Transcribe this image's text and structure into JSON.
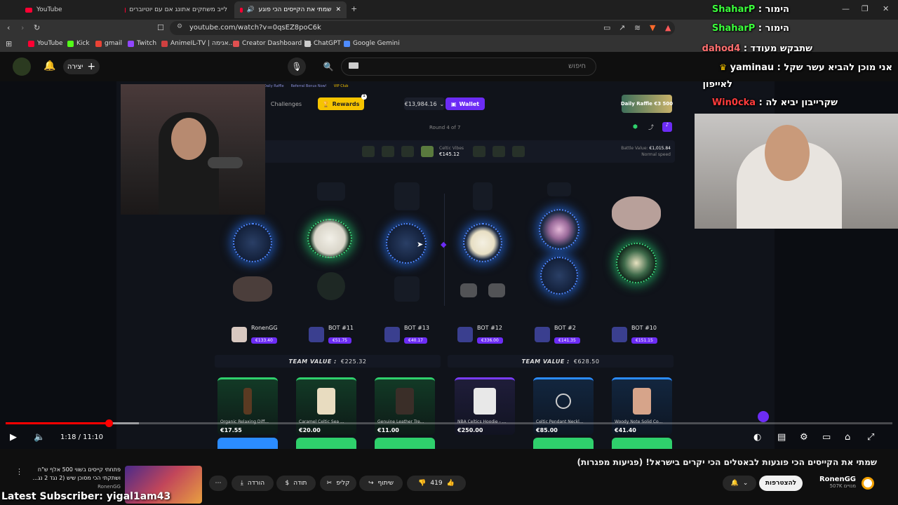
{
  "browser": {
    "tabs": [
      {
        "label": "YouTube"
      },
      {
        "label": "לייב משחקים אתונג אם עם יוטיוברים"
      },
      {
        "label": "שמתי את הקייסים הכי פוגעים לבאטלים הכי יקרים בישראל! (פגיעות מפגרות)"
      }
    ],
    "url": "youtube.com/watch?v=0qsEZ8poC6k",
    "bookmarks": [
      {
        "label": "YouTube",
        "color": "#ff0033"
      },
      {
        "label": "Kick",
        "color": "#53fc18"
      },
      {
        "label": "gmail",
        "color": "#ea4335"
      },
      {
        "label": "Twitch",
        "color": "#9146ff"
      },
      {
        "label": "AnimeIL-TV | אנימה...",
        "color": "#d04040"
      },
      {
        "label": "Creator Dashboard |...",
        "color": "#e05050"
      },
      {
        "label": "ChatGPT",
        "color": "#cccccc"
      },
      {
        "label": "Google Gemini",
        "color": "#4f8cff"
      }
    ]
  },
  "youtube": {
    "create_label": "יצירה",
    "search_placeholder": "חיפוש",
    "video": {
      "time_current": "1:18",
      "time_total": "11:10",
      "time_display": "1:18 / 11:10",
      "progress_fraction": 0.1164,
      "buffered_fraction": 0.15
    },
    "title": "שמתי את הקייסים הכי פוגעות לבאטלים הכי יקרים בישראל! (פגיעות מפגרות)",
    "channel": {
      "name": "RonenGG",
      "subs": "507K מנויים",
      "subscribe_label": "להצטרפות"
    },
    "actions": {
      "likes": "419",
      "share": "שיתוף",
      "clip": "קליפ",
      "thanks": "תודה",
      "download": "הורדה"
    },
    "recommendation": {
      "title_line1": "פתחתי קייסים בשווי 500 אלף ש\"ח",
      "title_line2": "ושתקתי הכי מסוכן שיש (2 נגד 2 נג...",
      "channel": "RonenGG"
    }
  },
  "game": {
    "challenges_label": "Challenges",
    "rewards_label": "Rewards",
    "rewards_badge": "1",
    "balance": "€13,984.16",
    "wallet_label": "Wallet",
    "daily_raffle": "Daily Raffle €3 500",
    "round_label": "Round 4 of 7",
    "current_case": {
      "name": "Celtic Vibes",
      "price": "€145.12"
    },
    "battle_value_label": "Battle Value:",
    "battle_value": "€1,015.84",
    "speed_label": "Normal speed",
    "players": [
      {
        "name": "RonenGG",
        "value": "€133.40"
      },
      {
        "name": "BOT #11",
        "value": "€51.75"
      },
      {
        "name": "BOT #13",
        "value": "€40.17"
      },
      {
        "name": "BOT #12",
        "value": "€336.00"
      },
      {
        "name": "BOT #2",
        "value": "€141.35"
      },
      {
        "name": "BOT #10",
        "value": "€151.15"
      }
    ],
    "team_value_label": "TEAM VALUE :",
    "team_values": [
      "€225.32",
      "€628.50"
    ],
    "cards": [
      {
        "name": "Organic Relaxing Diff...",
        "value": "€17.55",
        "tier": "green"
      },
      {
        "name": "Caramel Celtic Sea ...",
        "value": "€20.00",
        "tier": "green"
      },
      {
        "name": "Genuine Leather Tre...",
        "value": "€11.00",
        "tier": "green"
      },
      {
        "name": "NBA Celtics Hoodie - ...",
        "value": "€250.00",
        "tier": "purple"
      },
      {
        "name": "Celtic Pendant Neckl...",
        "value": "€85.00",
        "tier": "blue"
      },
      {
        "name": "Woody Note Solid Co...",
        "value": "€41.40",
        "tier": "blue"
      }
    ],
    "top_links": [
      "Daily Raffle",
      "Referral Bonus Now!",
      "VIP Club"
    ]
  },
  "overlay": {
    "chat": [
      {
        "user": "ShaharP",
        "text": "הימור :",
        "user_color": "#3cff3c"
      },
      {
        "user": "ShaharP",
        "text": "הימור :",
        "user_color": "#3cff3c"
      },
      {
        "user": "dahod4",
        "text": "שתבקש מעודד :",
        "user_color": "#ff6f6f"
      },
      {
        "user": "yaminau",
        "text": "אני מוכן להביא עשר שקל :",
        "user_color": "#ffffff"
      },
      {
        "user": "",
        "text": "לאייפון",
        "user_color": "#ffffff"
      },
      {
        "user": "Win0cka",
        "text": "שקרייבון יביא לה :",
        "user_color": "#ff3b3b"
      }
    ],
    "latest_subscriber": "Latest Subscriber: yigal1am43"
  },
  "colors": {
    "accent_purple": "#6c2cf5",
    "rewards_yellow": "#f6c400",
    "youtube_red": "#ff0000",
    "green_tier": "#2fd06c",
    "blue_tier": "#2b8cff",
    "purple_tier": "#7a3cff"
  }
}
